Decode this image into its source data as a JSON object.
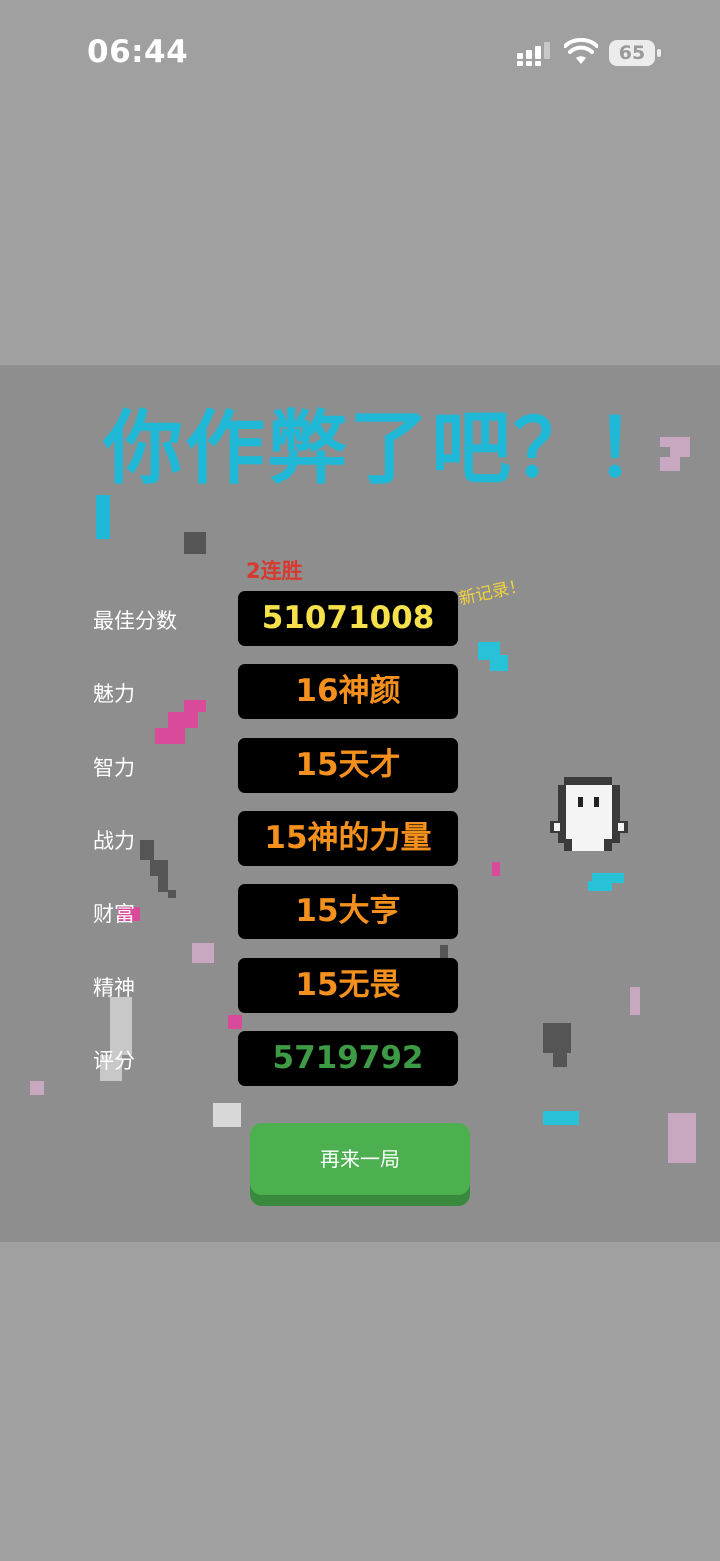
{
  "status_bar": {
    "time": "06:44",
    "battery_level": "65"
  },
  "game": {
    "title": "你作弊了吧？！",
    "streak": "2连胜",
    "new_record": "新记录！",
    "stats": [
      {
        "label": "最佳分数",
        "value": "51071008",
        "color": "#f6e04b"
      },
      {
        "label": "魅力",
        "value": "16神颜",
        "color": "#f4901e"
      },
      {
        "label": "智力",
        "value": "15天才",
        "color": "#f4901e"
      },
      {
        "label": "战力",
        "value": "15神的力量",
        "color": "#f4901e"
      },
      {
        "label": "财富",
        "value": "15大亨",
        "color": "#f4901e"
      },
      {
        "label": "精神",
        "value": "15无畏",
        "color": "#f4901e"
      },
      {
        "label": "评分",
        "value": "5719792",
        "color": "#3d9a45"
      }
    ],
    "replay_button": "再来一局"
  },
  "colors": {
    "page_background": "#a0a0a0",
    "game_background": "#8e8e8e",
    "title": "#1fb8d6",
    "streak": "#d63a2f",
    "button": "#4cb050"
  }
}
